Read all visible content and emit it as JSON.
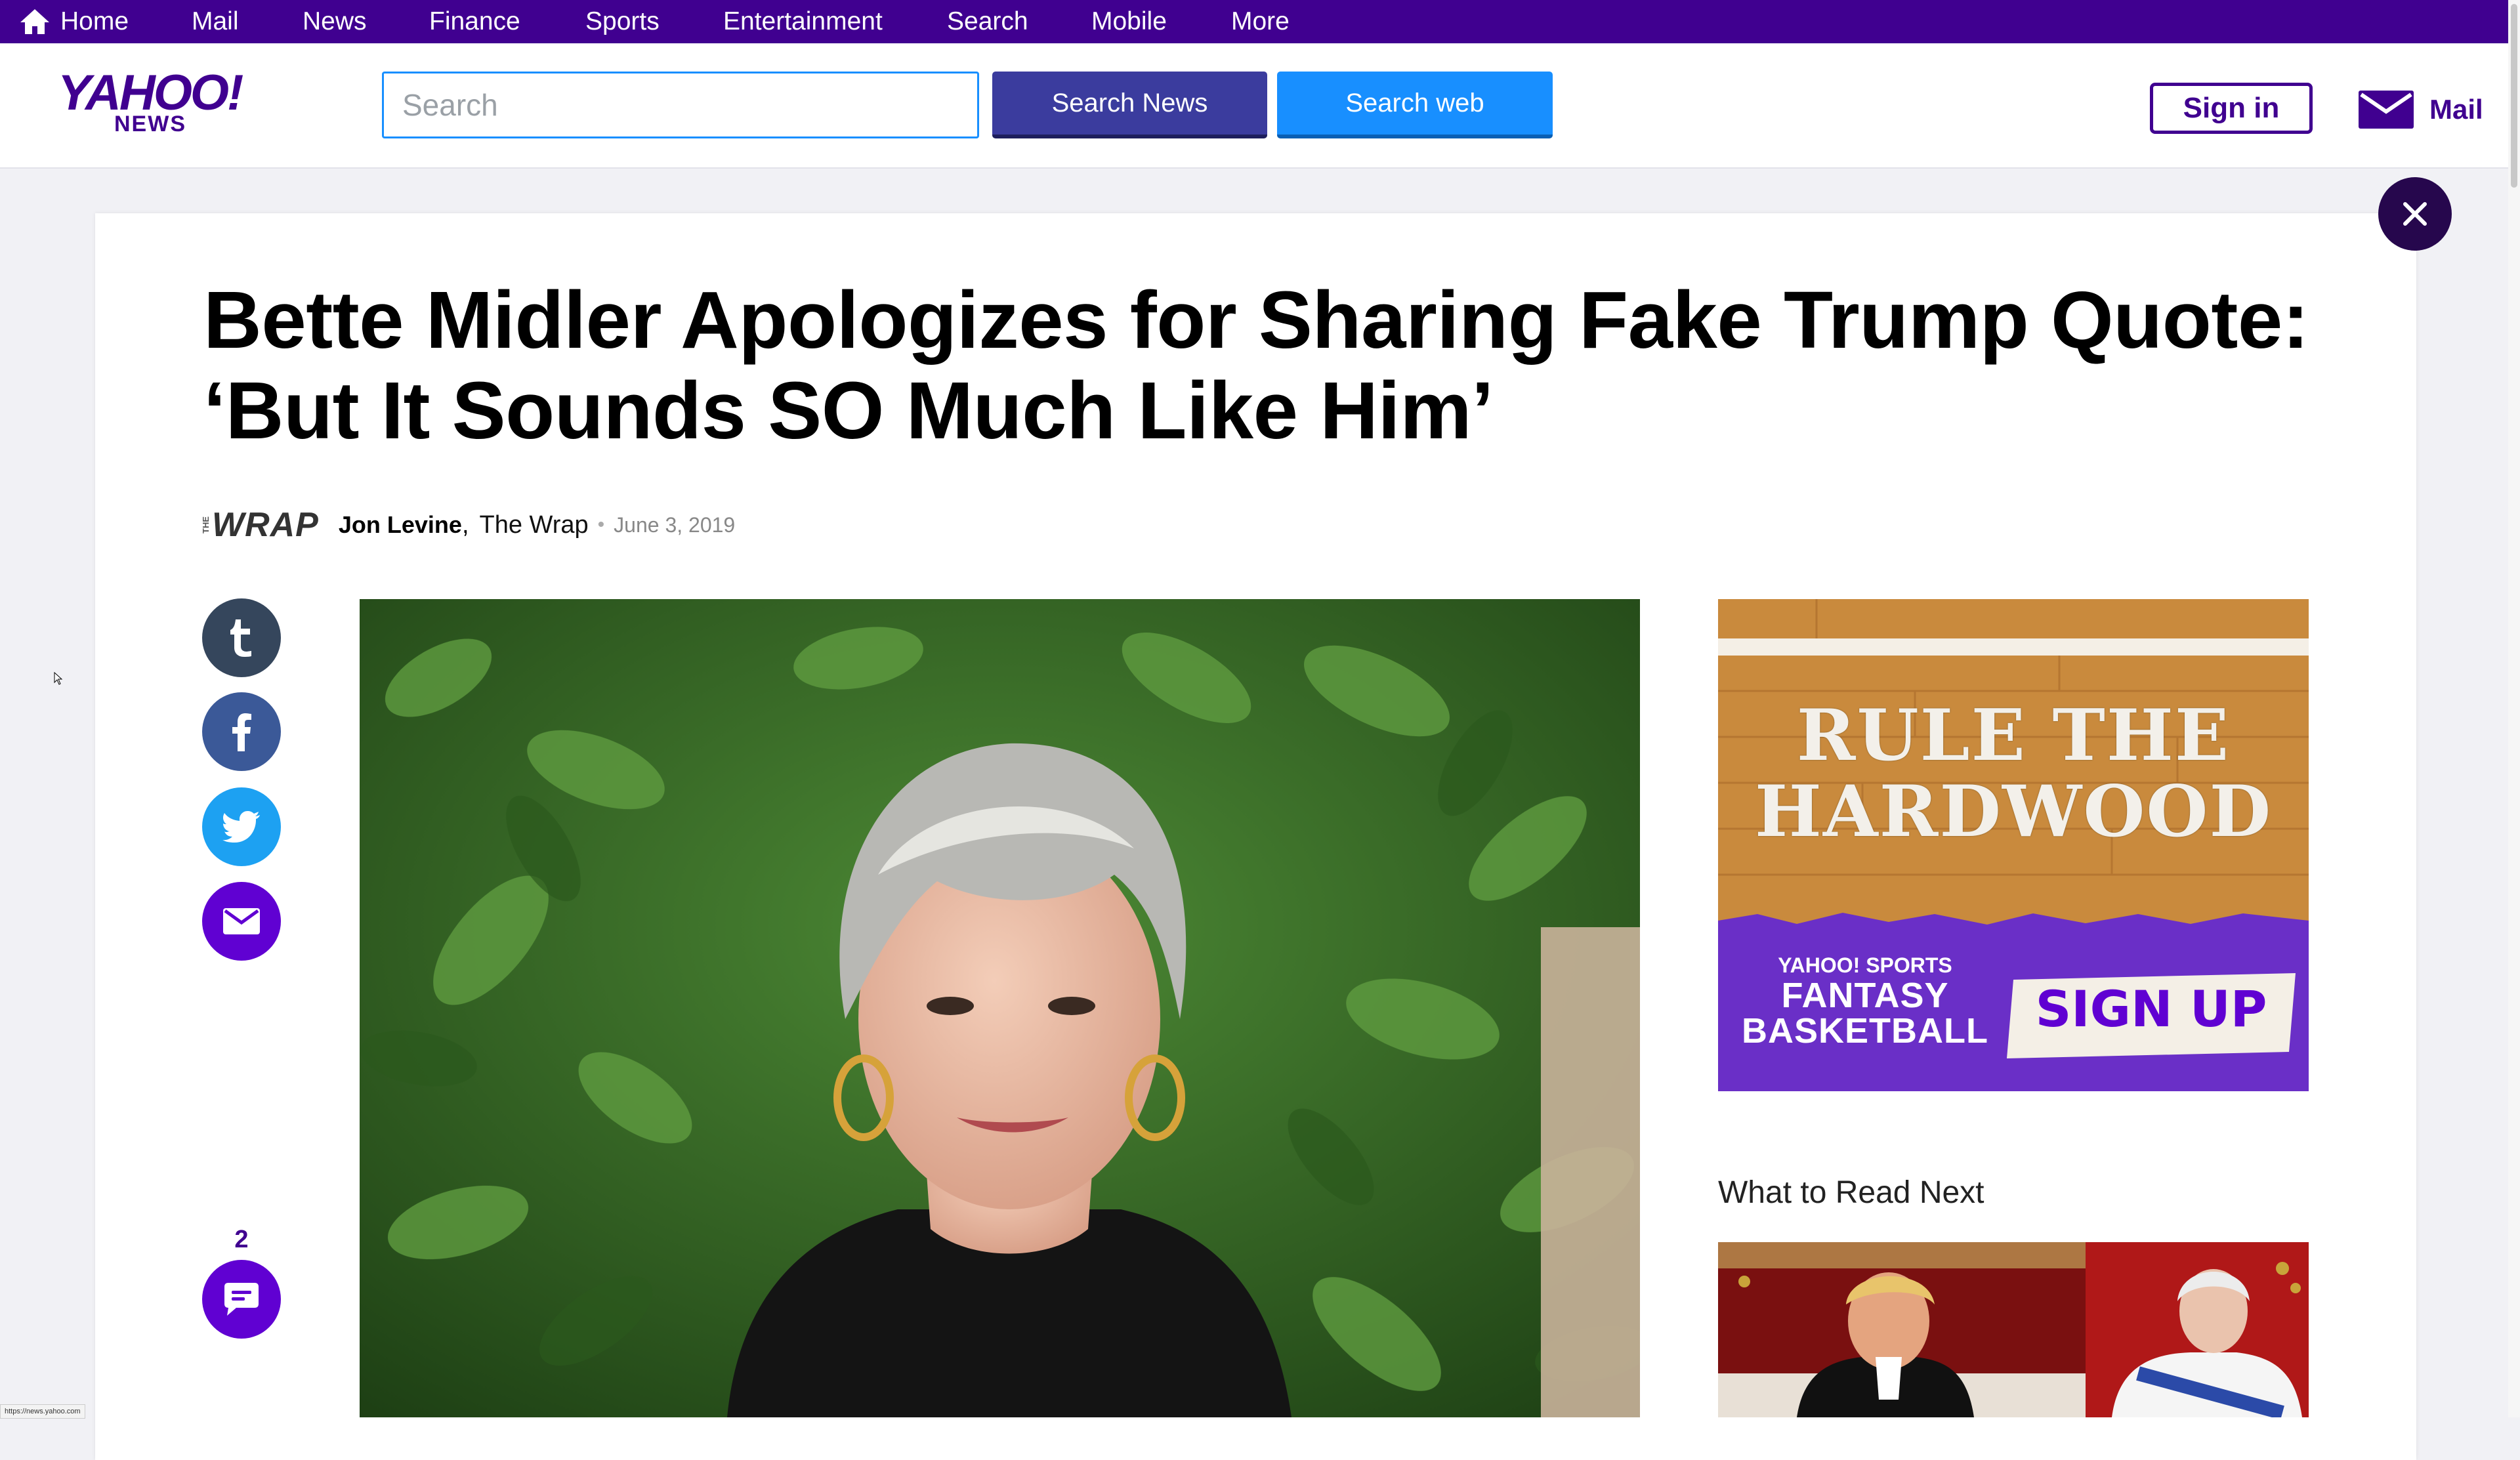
{
  "topnav": {
    "items": [
      "Home",
      "Mail",
      "News",
      "Finance",
      "Sports",
      "Entertainment",
      "Search",
      "Mobile",
      "More"
    ]
  },
  "header": {
    "logo_main": "YAHOO!",
    "logo_sub": "NEWS",
    "search_placeholder": "Search",
    "search_news_label": "Search News",
    "search_web_label": "Search web",
    "signin_label": "Sign in",
    "mail_label": "Mail"
  },
  "article": {
    "headline": "Bette Midler Apologizes for Sharing Fake Trump Quote: ‘But It Sounds SO Much Like Him’",
    "provider_logo_small": "THE",
    "provider_logo": "WRAP",
    "author": "Jon Levine",
    "provider": "The Wrap",
    "date": "June 3, 2019",
    "comment_count": "2"
  },
  "ad": {
    "headline_line1": "RULE THE",
    "headline_line2": "HARDWOOD",
    "brand_line1": "YAHOO! SPORTS",
    "brand_line2": "FANTASY",
    "brand_line3": "BASKETBALL",
    "cta": "SIGN UP"
  },
  "sidebar": {
    "read_next_title": "What to Read Next"
  },
  "status_bar": {
    "url": "https://news.yahoo.com"
  },
  "colors": {
    "brand_purple": "#400090",
    "search_web_blue": "#188fff",
    "search_news_navy": "#3b3c9e",
    "tumblr": "#35465c",
    "facebook": "#3b5998",
    "twitter": "#1da1f2",
    "email_purple": "#6001d2"
  },
  "icons": [
    "home-icon",
    "mail-icon",
    "close-icon",
    "tumblr-icon",
    "facebook-icon",
    "twitter-icon",
    "email-icon",
    "comment-icon",
    "cursor-icon"
  ]
}
